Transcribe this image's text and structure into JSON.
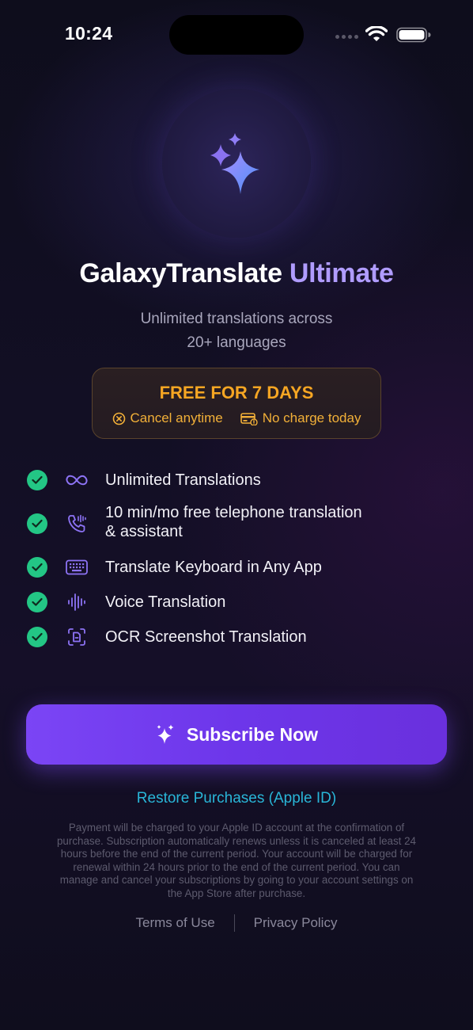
{
  "status_bar": {
    "time": "10:24"
  },
  "hero": {
    "icon": "sparkles-icon"
  },
  "title": {
    "main": "GalaxyTranslate",
    "accent": "Ultimate"
  },
  "subtitle": {
    "line1": "Unlimited translations across",
    "line2": "20+ languages"
  },
  "trial": {
    "title": "FREE FOR 7 DAYS",
    "cancel_label": "Cancel anytime",
    "charge_label": "No charge today"
  },
  "features": [
    {
      "icon": "infinity-icon",
      "text": "Unlimited Translations"
    },
    {
      "icon": "phone-wave-icon",
      "text": "10 min/mo free telephone translation",
      "text2": "& assistant"
    },
    {
      "icon": "keyboard-icon",
      "text": "Translate Keyboard in Any App"
    },
    {
      "icon": "waveform-icon",
      "text": "Voice Translation"
    },
    {
      "icon": "ocr-scan-icon",
      "text": "OCR Screenshot Translation"
    }
  ],
  "subscribe": {
    "label": "Subscribe Now"
  },
  "restore_label": "Restore Purchases (Apple ID)",
  "legal": {
    "line1": "Payment will be charged to your Apple ID account at the confirmation of",
    "line2": "purchase. Subscription automatically renews unless it is canceled at least 24",
    "line3": "hours before the end of the current period. Your account will be charged for",
    "line4": "renewal within 24 hours prior to the end of the current period. You can",
    "line5": "manage and cancel your subscriptions by going to your account settings on",
    "line6": "the App Store after purchase."
  },
  "links": {
    "terms": "Terms of Use",
    "privacy": "Privacy Policy"
  },
  "colors": {
    "accent": "#b09cff",
    "button": "#7341f0",
    "trial": "#f6a623",
    "check": "#23c685",
    "restore": "#29b6d8"
  }
}
